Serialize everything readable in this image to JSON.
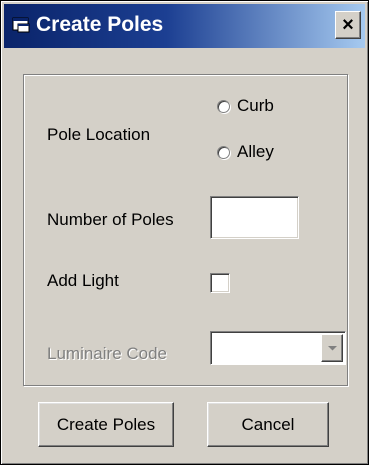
{
  "window": {
    "title": "Create Poles",
    "close_glyph": "×",
    "title_icon": "app-window-icon"
  },
  "form": {
    "pole_location_label": "Pole Location",
    "options": [
      {
        "label": "Curb",
        "selected": false
      },
      {
        "label": "Alley",
        "selected": false
      }
    ],
    "number_of_poles_label": "Number of Poles",
    "number_of_poles_value": "",
    "add_light_label": "Add Light",
    "add_light_checked": false,
    "luminaire_code_label": "Luminaire Code",
    "luminaire_code_value": "",
    "luminaire_code_enabled": false
  },
  "buttons": {
    "create_label": "Create Poles",
    "cancel_label": "Cancel"
  },
  "colors": {
    "title_start": "#0a246a",
    "title_end": "#a6caf0",
    "face": "#d4d0c8",
    "disabled_text": "#808080"
  }
}
